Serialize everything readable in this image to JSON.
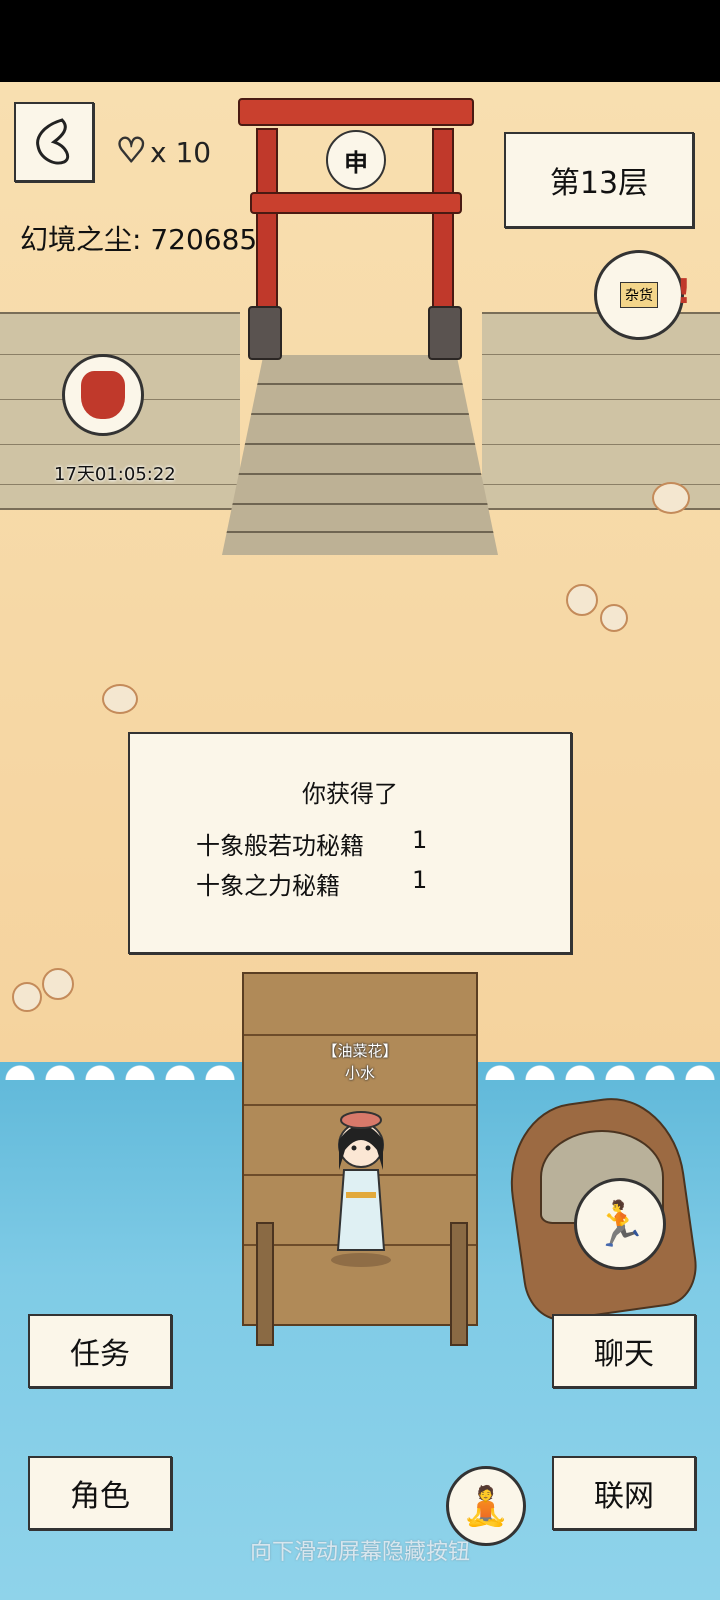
{
  "header": {
    "lives": "x 10",
    "dust_label": "幻境之尘: 720685",
    "floor": "第13层",
    "timer": "17天01:05:22",
    "shop_sign": "杂货",
    "gate_sign": "申"
  },
  "reward": {
    "title": "你获得了",
    "items": [
      {
        "name": "十象般若功秘籍",
        "qty": "1"
      },
      {
        "name": "十象之力秘籍",
        "qty": "1"
      }
    ]
  },
  "character": {
    "title": "【油菜花】",
    "name": "小水"
  },
  "menu": {
    "task": "任务",
    "role": "角色",
    "chat": "聊天",
    "network": "联网"
  },
  "hint": "向下滑动屏幕隐藏按钮",
  "icons": {
    "back": "back-arrow-icon",
    "heart": "heart-icon",
    "shop": "shop-icon",
    "bag": "lucky-bag-icon",
    "run": "run-icon",
    "meditate": "meditate-icon"
  },
  "colors": {
    "torii": "#c0392b",
    "sea": "#6cc0de",
    "sand": "#f6d9a6"
  }
}
